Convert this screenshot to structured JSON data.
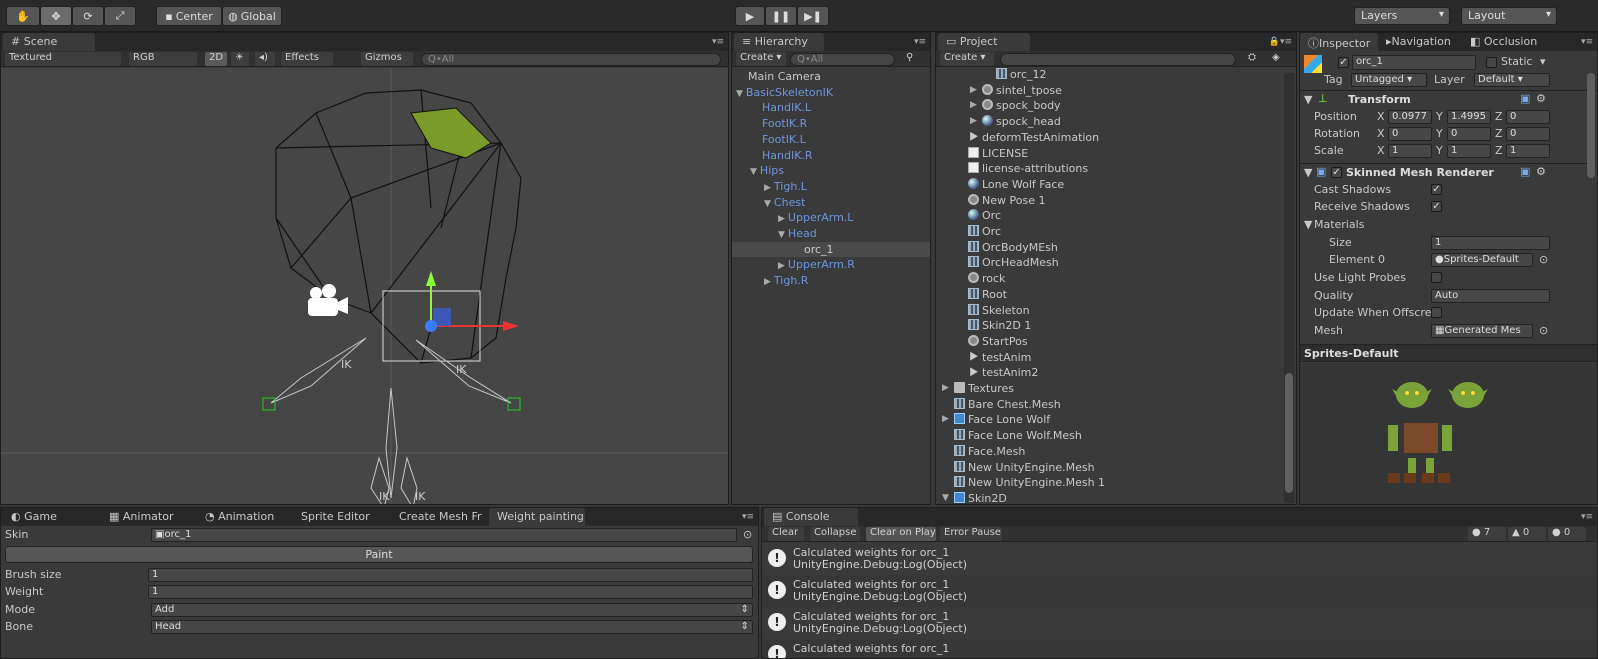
{
  "toolbar": {
    "tools": [
      "hand",
      "move",
      "rotate",
      "scale"
    ],
    "pivot": "Center",
    "space": "Global",
    "layers": "Layers",
    "layout": "Layout"
  },
  "scene": {
    "tab": "Scene",
    "draw_mode": "Textured",
    "render_mode": "RGB",
    "mode_2d": "2D",
    "effects": "Effects",
    "gizmos": "Gizmos",
    "search_placeholder": "Q•All",
    "ik_labels": [
      "IK",
      "IK",
      "IK",
      "IK"
    ]
  },
  "hierarchy": {
    "tab": "Hierarchy",
    "create": "Create",
    "search_placeholder": "Q•All",
    "items": [
      {
        "label": "Main Camera",
        "depth": 0,
        "blue": false,
        "arrow": ""
      },
      {
        "label": "BasicSkeletonIK",
        "depth": 0,
        "blue": true,
        "arrow": "▼"
      },
      {
        "label": "HandIK.L",
        "depth": 1,
        "blue": true,
        "arrow": ""
      },
      {
        "label": "FootIK.R",
        "depth": 1,
        "blue": true,
        "arrow": ""
      },
      {
        "label": "FootIK.L",
        "depth": 1,
        "blue": true,
        "arrow": ""
      },
      {
        "label": "HandIK.R",
        "depth": 1,
        "blue": true,
        "arrow": ""
      },
      {
        "label": "Hips",
        "depth": 1,
        "blue": true,
        "arrow": "▼"
      },
      {
        "label": "Tigh.L",
        "depth": 2,
        "blue": true,
        "arrow": "▶"
      },
      {
        "label": "Chest",
        "depth": 2,
        "blue": true,
        "arrow": "▼"
      },
      {
        "label": "UpperArm.L",
        "depth": 3,
        "blue": true,
        "arrow": "▶"
      },
      {
        "label": "Head",
        "depth": 3,
        "blue": true,
        "arrow": "▼"
      },
      {
        "label": "orc_1",
        "depth": 4,
        "blue": false,
        "arrow": "",
        "selected": true
      },
      {
        "label": "UpperArm.R",
        "depth": 3,
        "blue": true,
        "arrow": "▶"
      },
      {
        "label": "Tigh.R",
        "depth": 2,
        "blue": true,
        "arrow": "▶"
      }
    ]
  },
  "project": {
    "tab": "Project",
    "create": "Create",
    "items": [
      {
        "label": "orc_12",
        "indent": 3,
        "icon": "ic-mesh",
        "arrow": ""
      },
      {
        "label": "sintel_tpose",
        "indent": 2,
        "icon": "ic-gear",
        "arrow": "▶"
      },
      {
        "label": "spock_body",
        "indent": 2,
        "icon": "ic-gear",
        "arrow": "▶"
      },
      {
        "label": "spock_head",
        "indent": 2,
        "icon": "ic-sphere",
        "arrow": "▶"
      },
      {
        "label": "deformTestAnimation",
        "indent": 1,
        "icon": "ic-anim",
        "arrow": ""
      },
      {
        "label": "LICENSE",
        "indent": 1,
        "icon": "ic-doc",
        "arrow": ""
      },
      {
        "label": "license-attributions",
        "indent": 1,
        "icon": "ic-doc",
        "arrow": ""
      },
      {
        "label": "Lone Wolf Face",
        "indent": 1,
        "icon": "ic-sphere",
        "arrow": ""
      },
      {
        "label": "New Pose 1",
        "indent": 1,
        "icon": "ic-gear",
        "arrow": ""
      },
      {
        "label": "Orc",
        "indent": 1,
        "icon": "ic-sphere",
        "arrow": ""
      },
      {
        "label": "Orc",
        "indent": 1,
        "icon": "ic-mesh",
        "arrow": ""
      },
      {
        "label": "OrcBodyMEsh",
        "indent": 1,
        "icon": "ic-mesh",
        "arrow": ""
      },
      {
        "label": "OrcHeadMesh",
        "indent": 1,
        "icon": "ic-mesh",
        "arrow": ""
      },
      {
        "label": "rock",
        "indent": 1,
        "icon": "ic-gear",
        "arrow": ""
      },
      {
        "label": "Root",
        "indent": 1,
        "icon": "ic-mesh",
        "arrow": ""
      },
      {
        "label": "Skeleton",
        "indent": 1,
        "icon": "ic-mesh",
        "arrow": ""
      },
      {
        "label": "Skin2D 1",
        "indent": 1,
        "icon": "ic-mesh",
        "arrow": ""
      },
      {
        "label": "StartPos",
        "indent": 1,
        "icon": "ic-gear",
        "arrow": ""
      },
      {
        "label": "testAnim",
        "indent": 1,
        "icon": "ic-anim",
        "arrow": ""
      },
      {
        "label": "testAnim2",
        "indent": 1,
        "icon": "ic-anim",
        "arrow": ""
      },
      {
        "label": "Textures",
        "indent": 0,
        "icon": "ic-folder",
        "arrow": "▶"
      },
      {
        "label": "Bare Chest.Mesh",
        "indent": 0,
        "icon": "ic-mesh",
        "arrow": ""
      },
      {
        "label": "Face Lone Wolf",
        "indent": 0,
        "icon": "ic-prefab",
        "arrow": "▶"
      },
      {
        "label": "Face Lone Wolf.Mesh",
        "indent": 0,
        "icon": "ic-mesh",
        "arrow": ""
      },
      {
        "label": "Face.Mesh",
        "indent": 0,
        "icon": "ic-mesh",
        "arrow": ""
      },
      {
        "label": "New UnityEngine.Mesh",
        "indent": 0,
        "icon": "ic-mesh",
        "arrow": ""
      },
      {
        "label": "New UnityEngine.Mesh 1",
        "indent": 0,
        "icon": "ic-mesh",
        "arrow": ""
      },
      {
        "label": "Skin2D",
        "indent": 0,
        "icon": "ic-prefab",
        "arrow": "▼"
      }
    ]
  },
  "inspector": {
    "tabs": [
      "Inspector",
      "Navigation",
      "Occlusion"
    ],
    "object_name": "orc_1",
    "static_label": "Static",
    "tag_label": "Tag",
    "tag_value": "Untagged",
    "layer_label": "Layer",
    "layer_value": "Default",
    "transform": {
      "title": "Transform",
      "position_label": "Position",
      "rotation_label": "Rotation",
      "scale_label": "Scale",
      "position": {
        "x": "0.0977",
        "y": "1.4995",
        "z": "0"
      },
      "rotation": {
        "x": "0",
        "y": "0",
        "z": "0"
      },
      "scale": {
        "x": "1",
        "y": "1",
        "z": "1"
      }
    },
    "smr": {
      "title": "Skinned Mesh Renderer",
      "cast_shadows": "Cast Shadows",
      "receive_shadows": "Receive Shadows",
      "materials": "Materials",
      "size_label": "Size",
      "size_value": "1",
      "element0_label": "Element 0",
      "element0_value": "Sprites-Default",
      "light_probes": "Use Light Probes",
      "quality_label": "Quality",
      "quality_value": "Auto",
      "offscreen": "Update When Offscre",
      "mesh_label": "Mesh",
      "mesh_value": "Generated Mes"
    },
    "preview_title": "Sprites-Default",
    "check": "✓"
  },
  "bottom_left": {
    "tabs": [
      "Game",
      "Animator",
      "Animation",
      "Sprite Editor",
      "Create Mesh Fr",
      "Weight painting"
    ],
    "skin_label": "Skin",
    "skin_value": "orc_1",
    "paint_button": "Paint",
    "brush_label": "Brush size",
    "brush_value": "1",
    "weight_label": "Weight",
    "weight_value": "1",
    "mode_label": "Mode",
    "mode_value": "Add",
    "bone_label": "Bone",
    "bone_value": "Head"
  },
  "console": {
    "tab": "Console",
    "buttons": [
      "Clear",
      "Collapse",
      "Clear on Play",
      "Error Pause"
    ],
    "counts": {
      "log": "7",
      "warn": "0",
      "error": "0"
    },
    "entries": [
      {
        "line1": "Calculated weights for orc_1",
        "line2": "UnityEngine.Debug:Log(Object)"
      },
      {
        "line1": "Calculated weights for orc_1",
        "line2": "UnityEngine.Debug:Log(Object)"
      },
      {
        "line1": "Calculated weights for orc_1",
        "line2": "UnityEngine.Debug:Log(Object)"
      },
      {
        "line1": "Calculated weights for orc_1",
        "line2": ""
      }
    ]
  }
}
